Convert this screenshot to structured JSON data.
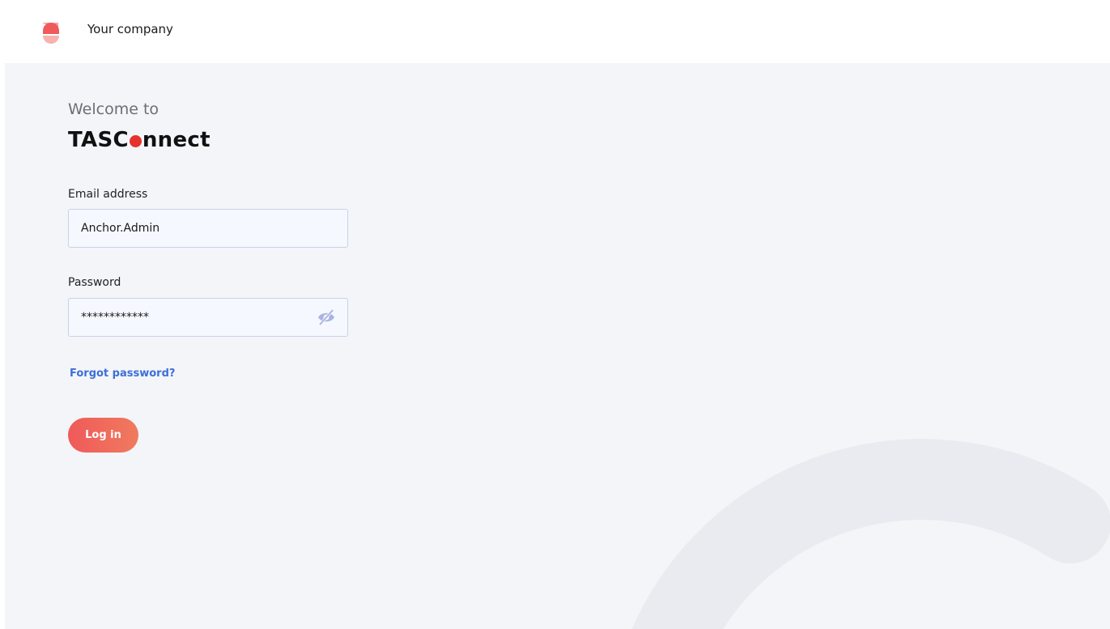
{
  "header": {
    "company_name": "Your company",
    "logo_icon": "company-logo-icon"
  },
  "login": {
    "welcome": "Welcome to",
    "brand_prefix": "TASC",
    "brand_suffix": "nnect",
    "email": {
      "label": "Email address",
      "value": "Anchor.Admin"
    },
    "password": {
      "label": "Password",
      "value": "************",
      "toggle_icon": "eye-off-icon"
    },
    "forgot_link": "Forgot password?",
    "login_button": "Log in"
  },
  "colors": {
    "accent": "#ef5a5a",
    "brand_dot": "#e6322d",
    "link": "#3b6fd8",
    "background": "#f4f5f9",
    "input_bg": "#f5f8ff"
  }
}
